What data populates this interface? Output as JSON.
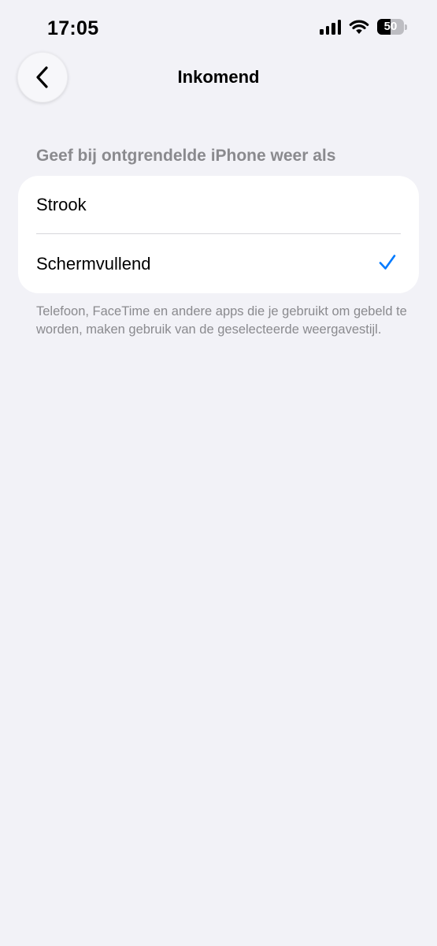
{
  "status_bar": {
    "time": "17:05",
    "battery_level": "50",
    "signal_icon": "cellular-signal-icon",
    "wifi_icon": "wifi-icon"
  },
  "nav": {
    "back_icon": "chevron-left-icon",
    "title": "Inkomend"
  },
  "section": {
    "header": "Geef bij ontgrendelde iPhone weer als",
    "options": [
      {
        "label": "Strook",
        "selected": false
      },
      {
        "label": "Schermvullend",
        "selected": true
      }
    ],
    "footer": "Telefoon, FaceTime en andere apps die je gebruikt om gebeld te worden, maken gebruik van de geselecteerde weergavestijl."
  },
  "colors": {
    "background": "#f2f2f7",
    "accent": "#007aff",
    "secondary_text": "#8a8a8e"
  }
}
